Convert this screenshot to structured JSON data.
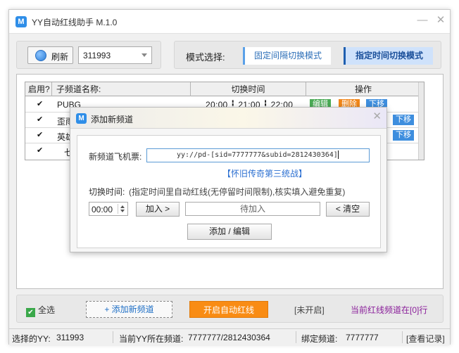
{
  "window": {
    "logo_letter": "M",
    "title": "YY自动红线助手  M.1.0",
    "min_icon": "minimize-icon",
    "close_icon": "close-icon"
  },
  "toolbar": {
    "refresh_label": "刷新",
    "yy_value": "311993",
    "mode_label": "模式选择:",
    "mode_interval": "固定间隔切换模式",
    "mode_scheduled": "指定时间切换模式",
    "active_mode": "指定时间切换模式"
  },
  "table": {
    "headers": [
      "启用?",
      "子频道名称:",
      "切换时间",
      "操作"
    ],
    "rows": [
      {
        "enabled": true,
        "name": "PUBG",
        "time": "20:00 ┇ 21:00 ┇ 22:00",
        "ops": [
          "编辑",
          "删除",
          "下移"
        ]
      },
      {
        "enabled": true,
        "name": "歪雨",
        "time": "",
        "ops": [
          "下移"
        ]
      },
      {
        "enabled": true,
        "name": "英雄",
        "time": "",
        "ops": [
          "下移"
        ]
      },
      {
        "enabled": true,
        "name": "七",
        "time": "",
        "ops": []
      }
    ]
  },
  "bottom": {
    "select_all": "全选",
    "add_channel": "+ 添加新频道",
    "start": "开启自动红线",
    "status": "[未开启]",
    "current_line": "当前红线频道在[0]行"
  },
  "statusbar": {
    "selected_yy_label": "选择的YY:",
    "selected_yy": "311993",
    "current_channel_label": "当前YY所在频道:",
    "current_channel": "7777777/2812430364",
    "bound_label": "绑定频道:",
    "bound": "7777777",
    "view_log": "[查看记录]"
  },
  "dialog": {
    "logo_letter": "M",
    "title": "添加新频道",
    "ticket_label": "新频道飞机票:",
    "ticket_value": "yy://pd-[sid=7777777&subid=2812430364]",
    "link_text": "【怀旧传奇第三统战】",
    "switch_time_label": "切换时间:",
    "switch_hint": "(指定时间里自动红线(无停留时间限制),核实填入避免重复)",
    "time_value": "00:00",
    "add_button": "加入 >",
    "pending_placeholder": "待加入",
    "clear_button": "< 清空",
    "submit_button": "添加 / 编辑"
  },
  "colors": {
    "accent_blue": "#2f8ee8",
    "edit_green": "#4aaa55",
    "delete_orange": "#f08518",
    "move_blue": "#3e8ede",
    "start_orange": "#f98c14",
    "status_purple": "#8a1f9a"
  }
}
